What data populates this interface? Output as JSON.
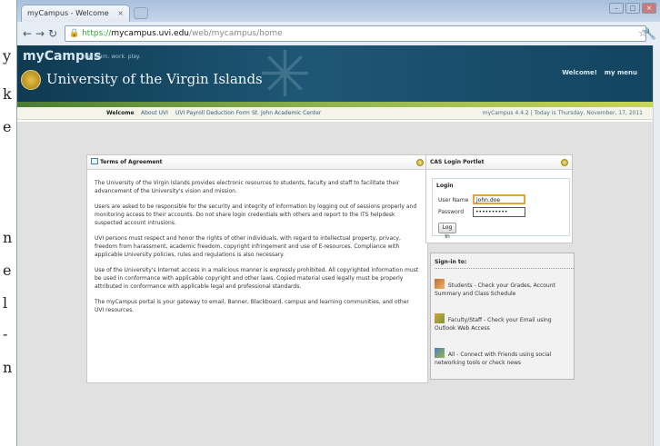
{
  "gutter": [
    "y",
    "k",
    "e",
    "n",
    "e",
    "l",
    "-",
    "n"
  ],
  "browser": {
    "tab_title": "myCampus - Welcome",
    "tab_close": "×",
    "url_scheme": "https://",
    "url_domain": "mycampus.uvi.edu",
    "url_path": "/web/mycampus/home",
    "lock_icon": "🔒"
  },
  "header": {
    "brand": "myCampus",
    "tagline": "live. learn. work. play.",
    "university": "University of the Virgin Islands",
    "welcome": "Welcome!",
    "my_menu": "my menu"
  },
  "nav": {
    "items": [
      "Welcome",
      "About UVI",
      "UVI Payroll Deduction Form",
      "St. John Academic Center"
    ],
    "status": "myCampus 4.4.2 | Today is Thursday, November, 17, 2011"
  },
  "terms": {
    "title": "Terms of Agreement",
    "paragraphs": [
      "The University of the Virgin Islands provides electronic resources to students, faculty and staff to facilitate their advancement of the University's vision and mission.",
      "Users are asked to be responsible for the security and integrity of information by logging out of sessions properly and monitoring access to their accounts. Do not share login credentials with others and report to the ITS helpdesk suspected account intrusions.",
      "UVI persons must respect and honor the rights of other individuals, with regard to intellectual property, privacy, freedom from harassment, academic freedom, copyright infringement and use of E-resources. Compliance with applicable University policies, rules and regulations is also necessary.",
      "Use of the University's Internet access in a malicious manner is expressly prohibited. All copyrighted information must be used in conformance with applicable copyright and other laws. Copied material used legally must be properly attributed in conformance with applicable legal and professional standards.",
      "The myCampus portal is your gateway to email, Banner, Blackboard, campus and learning communities, and other UVI resources."
    ]
  },
  "cas": {
    "title": "CAS Login Portlet",
    "legend": "Login",
    "username_label": "User Name",
    "username_value": "john.doe",
    "password_label": "Password",
    "password_value": "••••••••••",
    "login_button": "Log In"
  },
  "signin": {
    "title": "Sign-in to:",
    "items": [
      {
        "icon": "students-icon",
        "text": "Students - Check your Grades, Account Summary and Class Schedule"
      },
      {
        "icon": "faculty-icon",
        "text": "Faculty/Staff - Check your Email using Outlook Web Access"
      },
      {
        "icon": "all-icon",
        "text": "All - Connect with Friends using social networking tools or check news"
      }
    ]
  }
}
